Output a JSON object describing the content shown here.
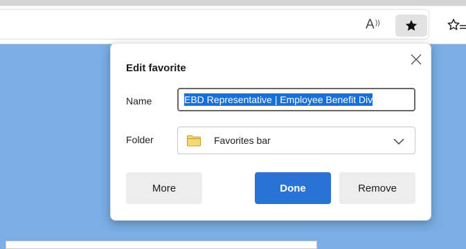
{
  "toolbar": {
    "read_aloud_icon": "read-aloud-icon",
    "favorite_icon": "star-filled-icon",
    "favorites_icon": "star-list-icon"
  },
  "dialog": {
    "title": "Edit favorite",
    "name_label": "Name",
    "name_value": "EBD Representative | Employee Benefit Div",
    "folder_label": "Folder",
    "folder_value": "Favorites bar",
    "more_label": "More",
    "done_label": "Done",
    "remove_label": "Remove"
  },
  "colors": {
    "page_background": "#7aaee4",
    "primary_button": "#2a73d6",
    "selection": "#1a6ed8",
    "folder_icon": "#f8d775"
  }
}
